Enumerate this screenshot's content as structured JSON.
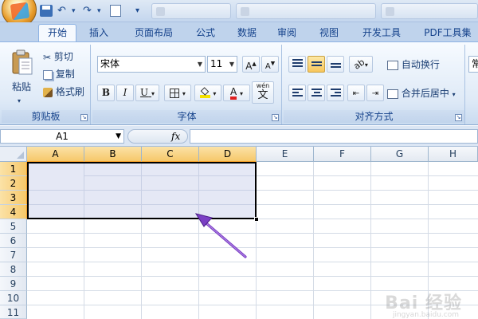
{
  "titlebar": {
    "window_tabs": [
      "",
      "",
      ""
    ]
  },
  "ribbon_tabs": [
    "开始",
    "插入",
    "页面布局",
    "公式",
    "数据",
    "审阅",
    "视图",
    "开发工具",
    "PDF工具集"
  ],
  "clipboard": {
    "paste": "粘贴",
    "cut": "剪切",
    "copy": "复制",
    "format_painter": "格式刷",
    "group_label": "剪贴板"
  },
  "font": {
    "name": "宋体",
    "size": "11",
    "group_label": "字体",
    "phonetic": "wén"
  },
  "alignment": {
    "wrap_text": "自动换行",
    "merge_center": "合并后居中",
    "group_label": "对齐方式"
  },
  "number": {
    "format": "常"
  },
  "formula_bar": {
    "name_box": "A1",
    "fx": "fx",
    "formula": ""
  },
  "grid": {
    "columns": [
      "A",
      "B",
      "C",
      "D",
      "E",
      "F",
      "G",
      "H"
    ],
    "rows": [
      "1",
      "2",
      "3",
      "4",
      "5",
      "6",
      "7",
      "8",
      "9",
      "10",
      "11"
    ],
    "selected_range": "A1:D4"
  },
  "watermark": {
    "text": "Bai 经验",
    "sub": "jingyan.baidu.com"
  },
  "colors": {
    "ribbon_bg": "#dfeaf7",
    "selection_fill": "#e6e9f4",
    "header_selected": "#f6c86a",
    "arrow": "#7b3fc4"
  }
}
